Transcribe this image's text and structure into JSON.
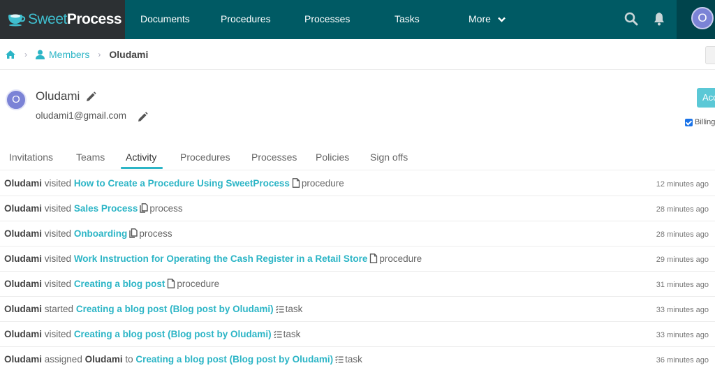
{
  "app": {
    "brand_sweet": "Sweet",
    "brand_process": "Process"
  },
  "nav": {
    "items": [
      "Documents",
      "Procedures",
      "Processes",
      "Tasks",
      "More"
    ],
    "search_icon": "search-icon",
    "bell_icon": "bell-icon",
    "avatar_initial": "O"
  },
  "breadcrumb": {
    "home_icon": "home-icon",
    "members_label": "Members",
    "current": "Oludami"
  },
  "profile": {
    "initial": "O",
    "name": "Oludami",
    "email": "oludami1@gmail.com",
    "action_button": "Acc",
    "billing_label": "Billing",
    "billing_checked": true
  },
  "tabs": {
    "items": [
      "Invitations",
      "Teams",
      "Activity",
      "Procedures",
      "Processes",
      "Policies",
      "Sign offs"
    ],
    "active": "Activity"
  },
  "activity": [
    {
      "actor": "Oludami",
      "verb": "visited",
      "target": "",
      "target_suffix": "",
      "link": "How to Create a Procedure Using SweetProcess",
      "icon": "document-icon",
      "type": "procedure",
      "time": "12 minutes ago"
    },
    {
      "actor": "Oludami",
      "verb": "visited",
      "target": "",
      "target_suffix": "",
      "link": "Sales Process",
      "icon": "copy-icon",
      "type": "process",
      "time": "28 minutes ago"
    },
    {
      "actor": "Oludami",
      "verb": "visited",
      "target": "",
      "target_suffix": "",
      "link": "Onboarding",
      "icon": "copy-icon",
      "type": "process",
      "time": "28 minutes ago"
    },
    {
      "actor": "Oludami",
      "verb": "visited",
      "target": "",
      "target_suffix": "",
      "link": "Work Instruction for Operating the Cash Register in a Retail Store",
      "icon": "document-icon",
      "type": "procedure",
      "time": "29 minutes ago"
    },
    {
      "actor": "Oludami",
      "verb": "visited",
      "target": "",
      "target_suffix": "",
      "link": "Creating a blog post",
      "icon": "document-icon",
      "type": "procedure",
      "time": "31 minutes ago"
    },
    {
      "actor": "Oludami",
      "verb": "started",
      "target": "",
      "target_suffix": "",
      "link": "Creating a blog post (Blog post by Oludami)",
      "icon": "task-list-icon",
      "type": "task",
      "time": "33 minutes ago"
    },
    {
      "actor": "Oludami",
      "verb": "visited",
      "target": "",
      "target_suffix": "",
      "link": "Creating a blog post (Blog post by Oludami)",
      "icon": "task-list-icon",
      "type": "task",
      "time": "33 minutes ago"
    },
    {
      "actor": "Oludami",
      "verb": "assigned",
      "target": "Oludami",
      "target_suffix": "to",
      "link": "Creating a blog post (Blog post by Oludami)",
      "icon": "task-list-icon",
      "type": "task",
      "time": "36 minutes ago"
    }
  ],
  "colors": {
    "nav_bg": "#005a64",
    "brand_bg": "#2c3033",
    "accent": "#2cb5c6",
    "avatar": "#7b83d6"
  }
}
